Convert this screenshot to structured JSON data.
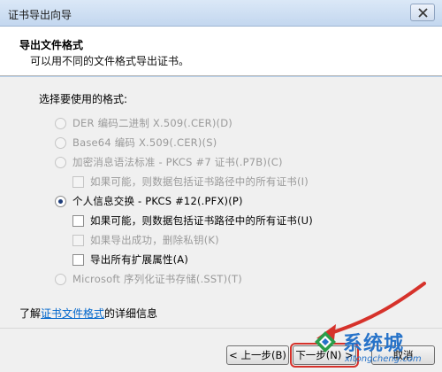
{
  "window": {
    "title": "证书导出向导",
    "close_label": "close"
  },
  "header": {
    "title": "导出文件格式",
    "subtitle": "可以用不同的文件格式导出证书。"
  },
  "prompt": "选择要使用的格式:",
  "options": [
    {
      "label": "DER 编码二进制 X.509(.CER)(D)",
      "type": "radio",
      "enabled": false,
      "checked": false
    },
    {
      "label": "Base64 编码 X.509(.CER)(S)",
      "type": "radio",
      "enabled": false,
      "checked": false
    },
    {
      "label": "加密消息语法标准 - PKCS #7 证书(.P7B)(C)",
      "type": "radio",
      "enabled": false,
      "checked": false
    },
    {
      "label": "如果可能，则数据包括证书路径中的所有证书(I)",
      "type": "checkbox",
      "enabled": false,
      "checked": false
    },
    {
      "label": "个人信息交换 - PKCS #12(.PFX)(P)",
      "type": "radio",
      "enabled": true,
      "checked": true
    },
    {
      "label": "如果可能，则数据包括证书路径中的所有证书(U)",
      "type": "checkbox",
      "enabled": true,
      "checked": false
    },
    {
      "label": "如果导出成功，删除私钥(K)",
      "type": "checkbox",
      "enabled": false,
      "checked": false
    },
    {
      "label": "导出所有扩展属性(A)",
      "type": "checkbox",
      "enabled": true,
      "checked": false
    },
    {
      "label": "Microsoft 序列化证书存储(.SST)(T)",
      "type": "radio",
      "enabled": false,
      "checked": false
    }
  ],
  "learn_more": {
    "prefix": "了解",
    "link": "证书文件格式",
    "suffix": "的详细信息"
  },
  "buttons": {
    "back": "< 上一步(B)",
    "next": "下一步(N) >",
    "cancel": "取消"
  },
  "watermark": {
    "brand": "系统城",
    "url": "xitongcheng.com"
  },
  "colors": {
    "highlight": "#d6322b",
    "link": "#0066cc",
    "watermark": "#2773c9"
  }
}
